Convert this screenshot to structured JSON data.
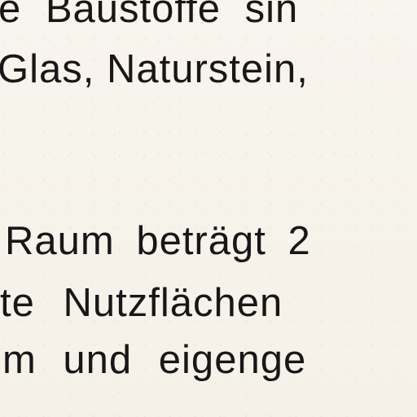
{
  "lines": [
    "e Baustoffe sin",
    "Glas, Naturstein,",
    "Raum beträgt 2",
    "te Nutzflächen",
    "m und eigenge"
  ]
}
